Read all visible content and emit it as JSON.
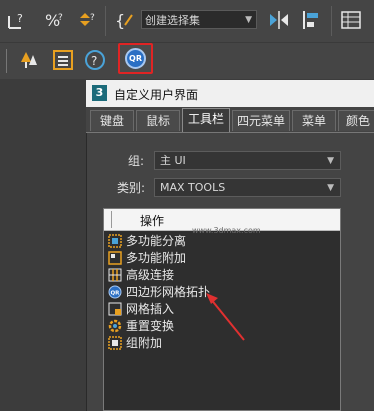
{
  "toolbar": {
    "selection_set_placeholder": "创建选择集",
    "icons": [
      "snap-2-5d-icon",
      "percent-snap-icon",
      "spinner-snap-icon",
      "edit-named-selection-icon",
      "mirror-icon",
      "align-icon",
      "scene-explorer-icon",
      "tree-icon",
      "layer-icon",
      "help-icon",
      "quad-remesh-icon"
    ]
  },
  "dialog": {
    "title": "自定义用户界面",
    "tabs": [
      "键盘",
      "鼠标",
      "工具栏",
      "四元菜单",
      "菜单",
      "颜色"
    ],
    "active_tab": "工具栏",
    "group_label": "组:",
    "group_value": "主 UI",
    "category_label": "类别:",
    "category_value": "MAX TOOLS",
    "list_header": "操作",
    "actions": [
      {
        "label": "多功能分离",
        "icon": "detach-icon"
      },
      {
        "label": "多功能附加",
        "icon": "attach-icon"
      },
      {
        "label": "高级连接",
        "icon": "connect-icon"
      },
      {
        "label": "四边形网格拓扑",
        "icon": "quad-remesh-icon"
      },
      {
        "label": "网格插入",
        "icon": "mesh-insert-icon"
      },
      {
        "label": "重置变换",
        "icon": "reset-xform-icon"
      },
      {
        "label": "组附加",
        "icon": "group-attach-icon"
      }
    ]
  },
  "watermark": "www.3dmax.com",
  "colors": {
    "highlight_border": "#e02424",
    "annotation_arrow": "#e03030",
    "qr_blue": "#2a6fc4"
  }
}
